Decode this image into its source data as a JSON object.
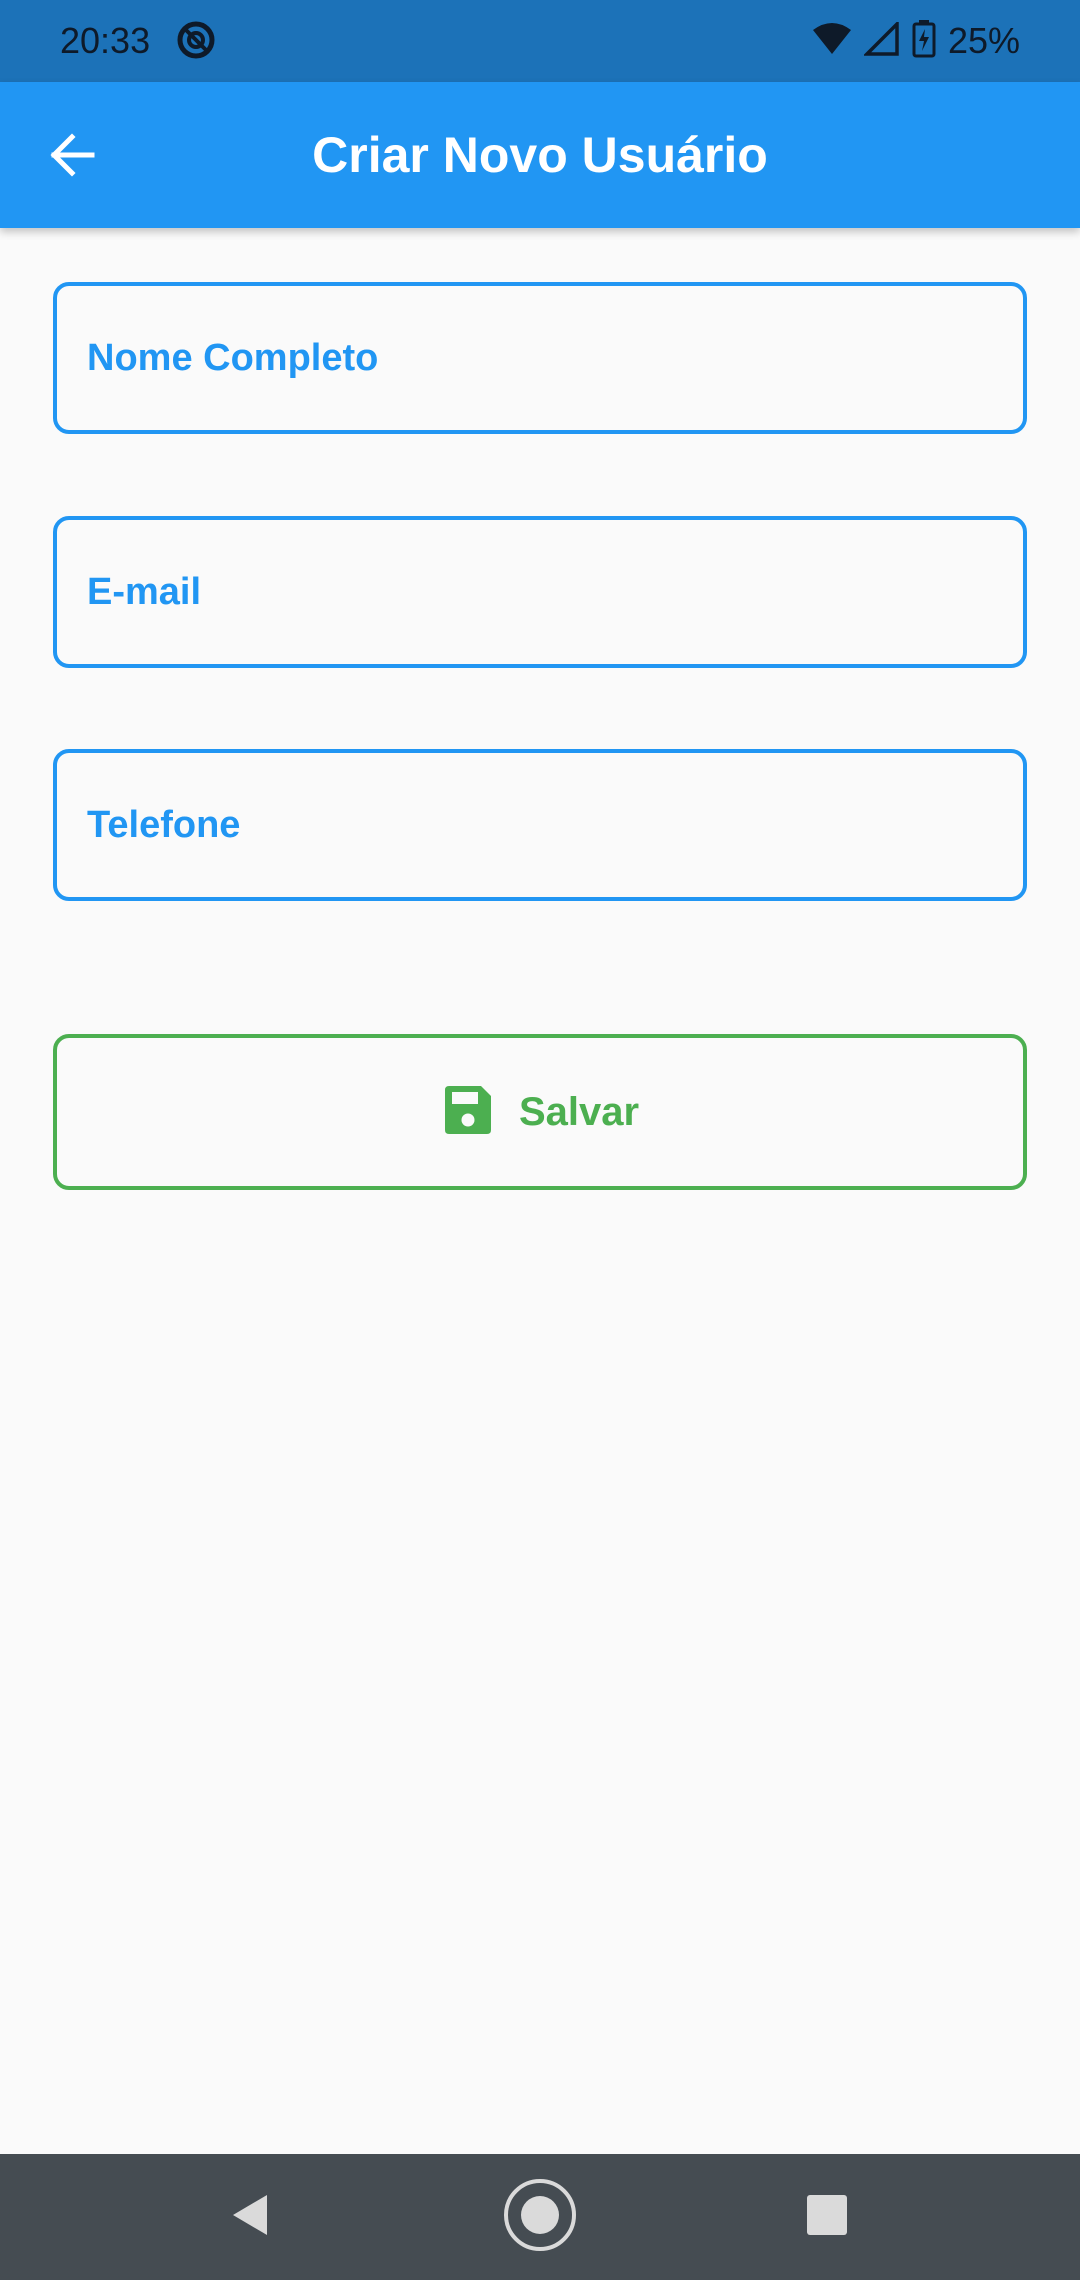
{
  "status_bar": {
    "time": "20:33",
    "battery_percent": "25%",
    "icons": [
      "do-not-disturb-icon",
      "wifi-icon",
      "cell-signal-icon",
      "battery-charging-icon"
    ]
  },
  "app_bar": {
    "title": "Criar Novo Usuário",
    "back_icon": "arrow-back-icon"
  },
  "form": {
    "name_field": {
      "placeholder": "Nome Completo",
      "value": ""
    },
    "email_field": {
      "placeholder": "E-mail",
      "value": ""
    },
    "phone_field": {
      "placeholder": "Telefone",
      "value": ""
    },
    "save_button": {
      "label": "Salvar",
      "icon": "save-icon"
    }
  },
  "nav_bar": {
    "buttons": [
      "back-triangle-icon",
      "home-circle-icon",
      "recents-square-icon"
    ]
  },
  "colors": {
    "primary": "#2196F3",
    "status_bar": "#1C72B8",
    "success": "#4CAF50",
    "background": "#FAFAFA",
    "nav_bar": "#454C52"
  }
}
